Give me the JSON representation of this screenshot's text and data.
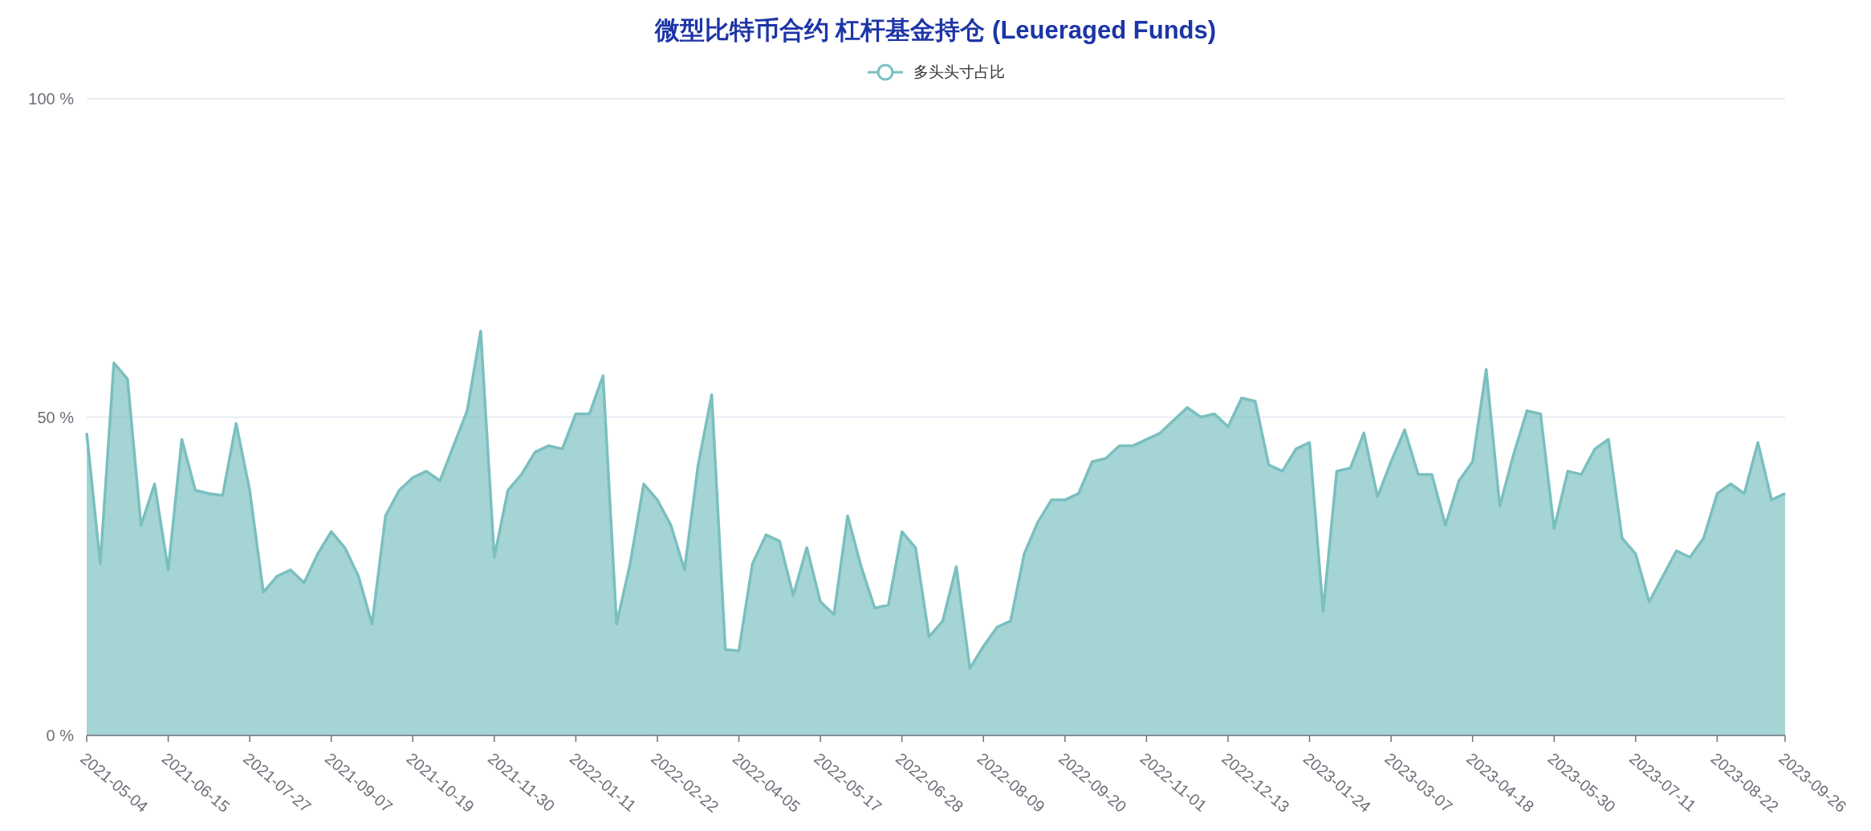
{
  "chart": {
    "title": "微型比特币合约 杠杆基金持仓 (Leueraged Funds)",
    "chart_data": {
      "type": "area",
      "categories": [
        "2021-05-04",
        null,
        null,
        null,
        null,
        null,
        "2021-06-15",
        null,
        null,
        null,
        null,
        null,
        "2021-07-27",
        null,
        null,
        null,
        null,
        null,
        "2021-09-07",
        null,
        null,
        null,
        null,
        null,
        "2021-10-19",
        null,
        null,
        null,
        null,
        null,
        "2021-11-30",
        null,
        null,
        null,
        null,
        null,
        "2022-01-11",
        null,
        null,
        null,
        null,
        null,
        "2022-02-22",
        null,
        null,
        null,
        null,
        null,
        "2022-04-05",
        null,
        null,
        null,
        null,
        null,
        "2022-05-17",
        null,
        null,
        null,
        null,
        null,
        "2022-06-28",
        null,
        null,
        null,
        null,
        null,
        "2022-08-09",
        null,
        null,
        null,
        null,
        null,
        "2022-09-20",
        null,
        null,
        null,
        null,
        null,
        "2022-11-01",
        null,
        null,
        null,
        null,
        null,
        "2022-12-13",
        null,
        null,
        null,
        null,
        null,
        "2023-01-24",
        null,
        null,
        null,
        null,
        null,
        "2023-03-07",
        null,
        null,
        null,
        null,
        null,
        "2023-04-18",
        null,
        null,
        null,
        null,
        null,
        "2023-05-30",
        null,
        null,
        null,
        null,
        null,
        "2023-07-11",
        null,
        null,
        null,
        null,
        null,
        "2023-08-22",
        null,
        null,
        null,
        null,
        "2023-09-26"
      ],
      "series": [
        {
          "name": "多头头寸占比",
          "color": "#7bbfbf",
          "values": [
            47.5,
            27,
            58.5,
            56,
            33,
            39.5,
            26,
            46.5,
            38.5,
            38,
            37.7,
            49,
            38.5,
            22.5,
            25,
            26,
            24,
            28.5,
            32,
            29.5,
            25,
            17.5,
            34.5,
            38.5,
            40.5,
            41.5,
            40,
            45.5,
            51,
            63.5,
            28,
            38.5,
            41,
            44.5,
            45.5,
            45,
            50.5,
            50.5,
            56.5,
            17.5,
            27,
            39.5,
            37,
            33,
            26,
            42.5,
            53.5,
            13.5,
            13.3,
            27,
            31.5,
            30.5,
            22,
            29.5,
            21,
            19,
            34.5,
            26.5,
            20,
            20.5,
            32,
            29.5,
            15.5,
            18,
            26.5,
            10.5,
            14,
            17,
            18,
            28.5,
            33.5,
            37,
            37,
            38,
            43,
            43.5,
            45.5,
            45.5,
            46.5,
            47.5,
            49.5,
            51.5,
            50,
            50.5,
            48.5,
            53,
            52.5,
            42.5,
            41.5,
            45,
            46,
            19.5,
            41.5,
            42,
            47.5,
            37.5,
            43,
            48,
            41,
            41,
            33,
            40,
            43,
            57.5,
            36,
            44,
            51,
            50.5,
            32.5,
            41.5,
            41,
            45,
            46.5,
            31,
            28.5,
            21,
            25,
            29,
            28,
            31,
            38,
            39.5,
            38,
            46,
            37,
            38
          ]
        }
      ],
      "ylim": [
        0,
        100
      ],
      "yticks": [
        {
          "value": 0,
          "label": "0 %"
        },
        {
          "value": 50,
          "label": "50 %"
        },
        {
          "value": 100,
          "label": "100 %"
        }
      ]
    }
  }
}
